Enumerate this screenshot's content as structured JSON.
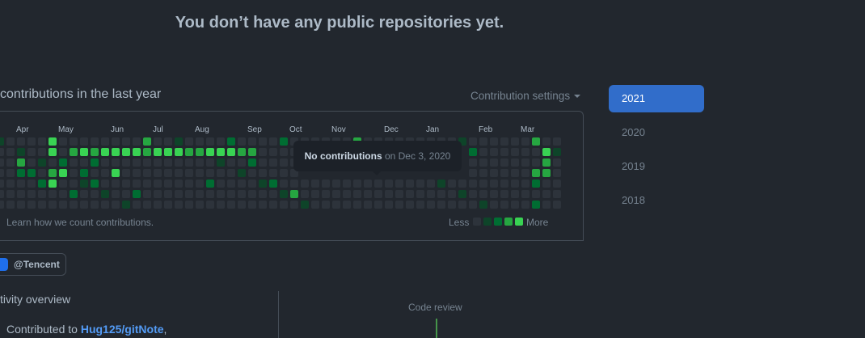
{
  "repos": {
    "empty_message": "You don’t have any public repositories yet."
  },
  "contributions": {
    "title": "contributions in the last year",
    "settings_label": "Contribution settings",
    "months": [
      "Apr",
      "May",
      "Jun",
      "Jul",
      "Aug",
      "Sep",
      "Oct",
      "Nov",
      "Dec",
      "Jan",
      "Feb",
      "Mar"
    ],
    "learn_text": "Learn how we count contributions.",
    "legend_less": "Less",
    "legend_more": "More",
    "tooltip_bold": "No contributions",
    "tooltip_rest": " on Dec 3, 2020",
    "colors": {
      "empty": "#2d333b",
      "l1": "#0e4429",
      "l2": "#006d32",
      "l3": "#26a641",
      "l4": "#39d353"
    }
  },
  "organization": {
    "label": "@Tencent"
  },
  "activity": {
    "title": "tivity overview",
    "contributed_prefix": "Contributed to ",
    "repo_link": "Hug125/gitNote",
    "contributed_suffix": ",",
    "code_review_label": "Code review"
  },
  "years": [
    "2021",
    "2020",
    "2019",
    "2018"
  ],
  "selected_year": "2021"
}
